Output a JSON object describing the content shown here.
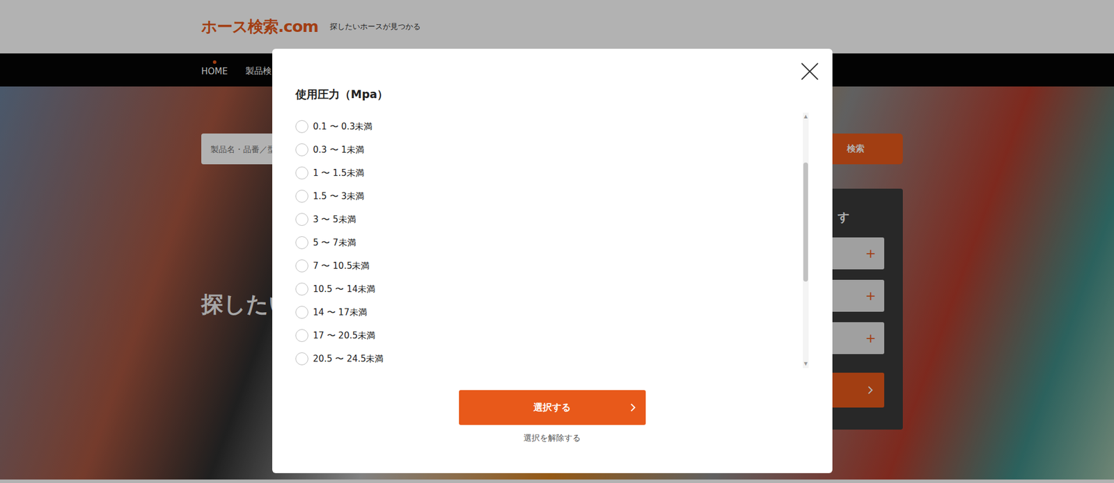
{
  "header": {
    "logo": "ホース検索.com",
    "tagline": "探したいホースが見つかる"
  },
  "nav": [
    {
      "label": "HOME",
      "selected": true
    },
    {
      "label": "製品検",
      "selected": false
    }
  ],
  "search": {
    "placeholder": "製品名・品番／型",
    "button": "検索"
  },
  "hero": {
    "heading": "探したい"
  },
  "side_panel": {
    "heading": "す",
    "rows": [
      "+",
      "+",
      "+"
    ]
  },
  "modal": {
    "title": "使用圧力（Mpa）",
    "options": [
      {
        "label": "0.1 〜 0.3未満",
        "selected": false
      },
      {
        "label": "0.3 〜 1未満",
        "selected": false
      },
      {
        "label": "1 〜 1.5未満",
        "selected": false
      },
      {
        "label": "1.5 〜 3未満",
        "selected": false
      },
      {
        "label": "3 〜 5未満",
        "selected": false
      },
      {
        "label": "5 〜 7未満",
        "selected": false
      },
      {
        "label": "7 〜 10.5未満",
        "selected": false
      },
      {
        "label": "10.5 〜 14未満",
        "selected": false
      },
      {
        "label": "14 〜 17未満",
        "selected": false
      },
      {
        "label": "17 〜 20.5未満",
        "selected": false
      },
      {
        "label": "20.5 〜 24.5未満",
        "selected": false
      }
    ],
    "scroll_arrows": [
      "▲",
      "▼"
    ],
    "confirm": "選択する",
    "clear": "選択を解除する"
  }
}
